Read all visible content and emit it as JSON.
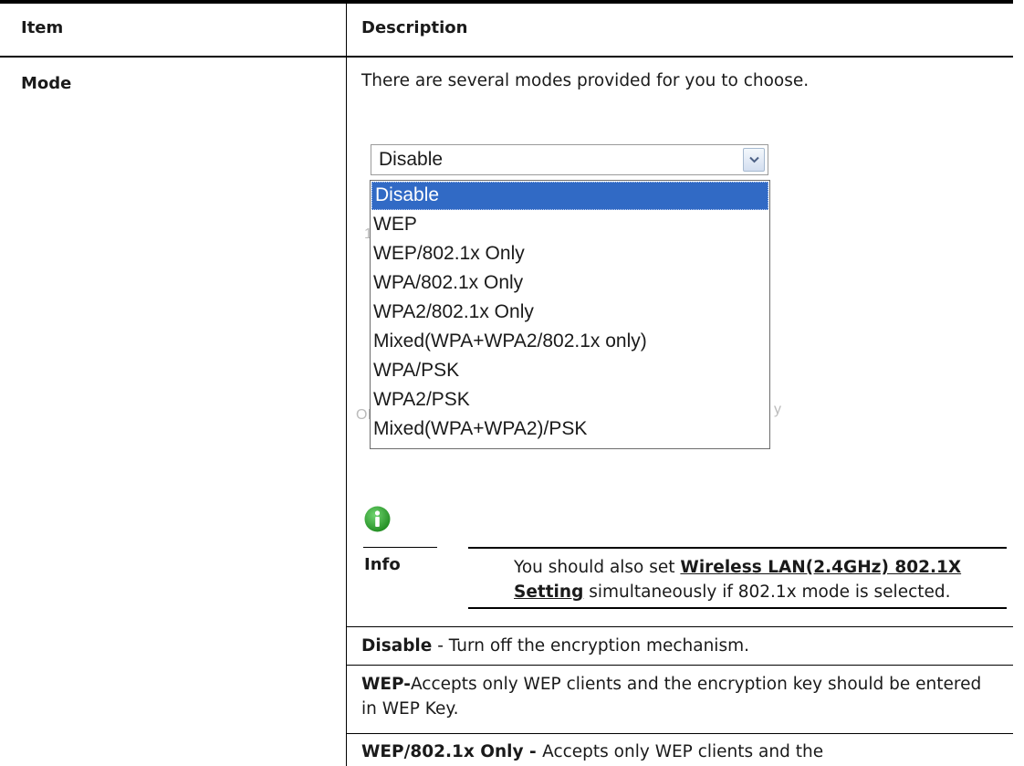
{
  "header": {
    "item": "Item",
    "description": "Description"
  },
  "row": {
    "item": "Mode",
    "intro": "There are several modes provided for you to choose.",
    "select": {
      "value": "Disable",
      "options": [
        "Disable",
        "WEP",
        "WEP/802.1x Only",
        "WPA/802.1x Only",
        "WPA2/802.1x Only",
        "Mixed(WPA+WPA2/802.1x only)",
        "WPA/PSK",
        "WPA2/PSK",
        "Mixed(WPA+WPA2)/PSK"
      ],
      "selected_index": 0
    },
    "info": {
      "label": "Info",
      "text_before": "You should also set ",
      "link": "Wireless LAN(2.4GHz) 802.1X Setting",
      "text_after": " simultaneously if 802.1x mode is selected."
    },
    "descriptions": [
      {
        "term": "Disable",
        "text": " - Turn off the encryption mechanism."
      },
      {
        "term": "WEP-",
        "text": "Accepts only WEP clients and the encryption key should be entered in WEP Key."
      },
      {
        "term": "WEP/802.1x Only - ",
        "text": "Accepts only WEP clients and the"
      }
    ]
  },
  "colors": {
    "highlight": "#316ac5",
    "info_icon": "#2e9e2e"
  },
  "icons": {
    "info": "info-icon",
    "dropdown": "chevron-down-icon"
  }
}
